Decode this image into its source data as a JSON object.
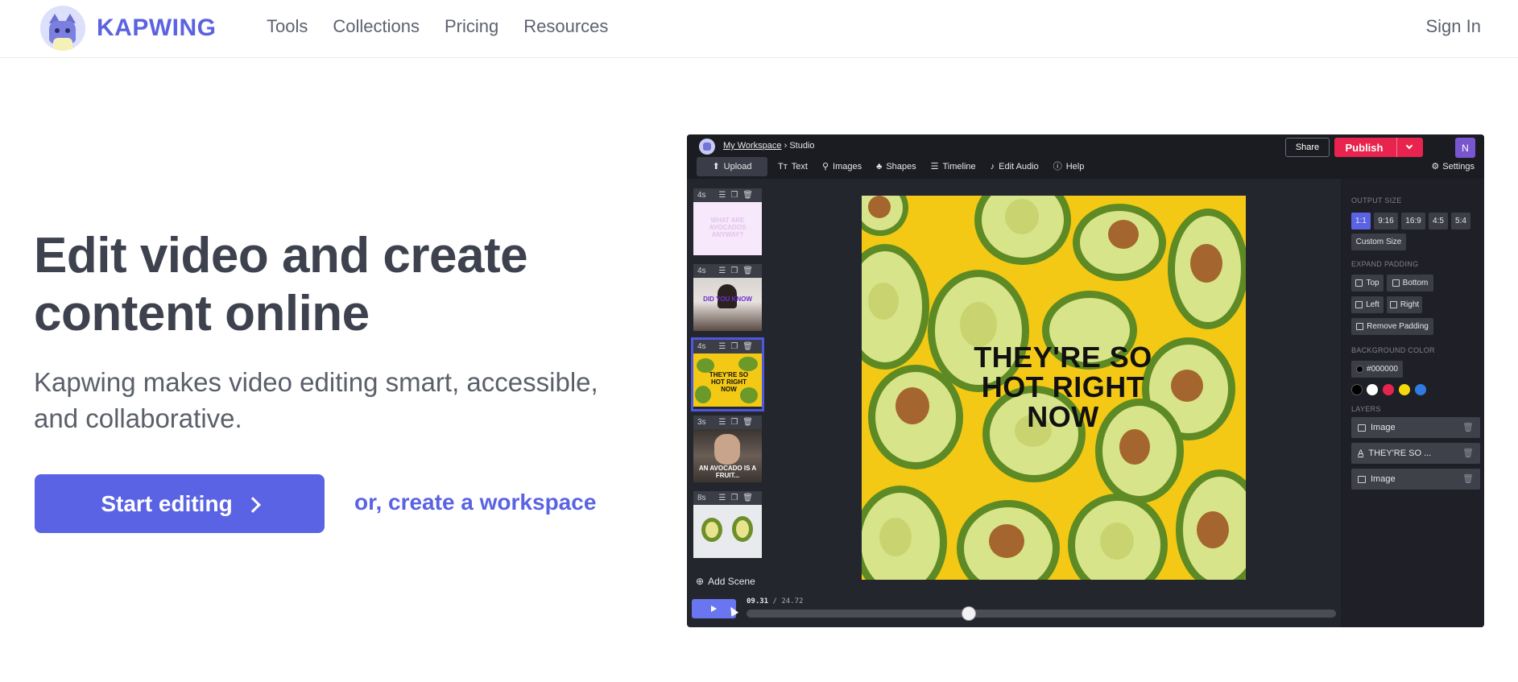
{
  "site": {
    "brand": "KAPWING",
    "nav": [
      "Tools",
      "Collections",
      "Pricing",
      "Resources"
    ],
    "sign_in": "Sign In"
  },
  "hero": {
    "title": "Edit video and create content online",
    "subtitle": "Kapwing makes video editing smart, accessible, and collaborative.",
    "cta_label": "Start editing",
    "secondary_link": "or, create a workspace"
  },
  "studio": {
    "breadcrumb_workspace": "My Workspace",
    "breadcrumb_sep": "›",
    "breadcrumb_page": "Studio",
    "share_label": "Share",
    "publish_label": "Publish",
    "user_initial": "N",
    "toolbar": [
      {
        "label": "Upload",
        "icon": "upload-icon",
        "glyph": "⬆"
      },
      {
        "label": "Text",
        "icon": "text-icon",
        "glyph": "Tт"
      },
      {
        "label": "Images",
        "icon": "search-icon",
        "glyph": "⚲"
      },
      {
        "label": "Shapes",
        "icon": "shapes-icon",
        "glyph": "♣"
      },
      {
        "label": "Timeline",
        "icon": "timeline-icon",
        "glyph": "☰"
      },
      {
        "label": "Edit Audio",
        "icon": "music-note-icon",
        "glyph": "♪"
      },
      {
        "label": "Help",
        "icon": "help-icon",
        "glyph": "ⓘ"
      }
    ],
    "settings_label": "Settings",
    "scenes": [
      {
        "duration": "4s",
        "text": "WHAT ARE AVOCADOS ANYWAY?"
      },
      {
        "duration": "4s",
        "text": "DID YOU KNOW"
      },
      {
        "duration": "4s",
        "text": "THEY'RE SO HOT RIGHT NOW"
      },
      {
        "duration": "3s",
        "text": "AN AVOCADO IS A FRUIT..."
      },
      {
        "duration": "8s",
        "text": ""
      }
    ],
    "add_scene_label": "Add Scene",
    "canvas_text": "THEY'RE SO HOT RIGHT NOW",
    "panel": {
      "output_size_label": "OUTPUT SIZE",
      "sizes": [
        "1:1",
        "9:16",
        "16:9",
        "4:5",
        "5:4"
      ],
      "selected_size": "1:1",
      "custom_size_label": "Custom Size",
      "expand_padding_label": "EXPAND PADDING",
      "padding_options": [
        "Top",
        "Bottom",
        "Left",
        "Right"
      ],
      "remove_padding_label": "Remove Padding",
      "background_color_label": "BACKGROUND COLOR",
      "background_color_value": "#000000",
      "swatches": [
        "#000000",
        "#ffffff",
        "#e8244e",
        "#f5d90a",
        "#2f7be0"
      ],
      "layers_label": "LAYERS",
      "layers": [
        {
          "label": "Image",
          "icon": "image-icon"
        },
        {
          "label": "THEY'RE SO ...",
          "icon": "text-layer-icon"
        },
        {
          "label": "Image",
          "icon": "image-icon"
        }
      ]
    },
    "playback": {
      "current_time": "09.31",
      "separator": " / ",
      "total_time": "24.72",
      "progress": 0.3766
    }
  },
  "colors": {
    "brand": "#5a63e3",
    "publish": "#e8244e",
    "canvas_background": "#f3c915"
  }
}
